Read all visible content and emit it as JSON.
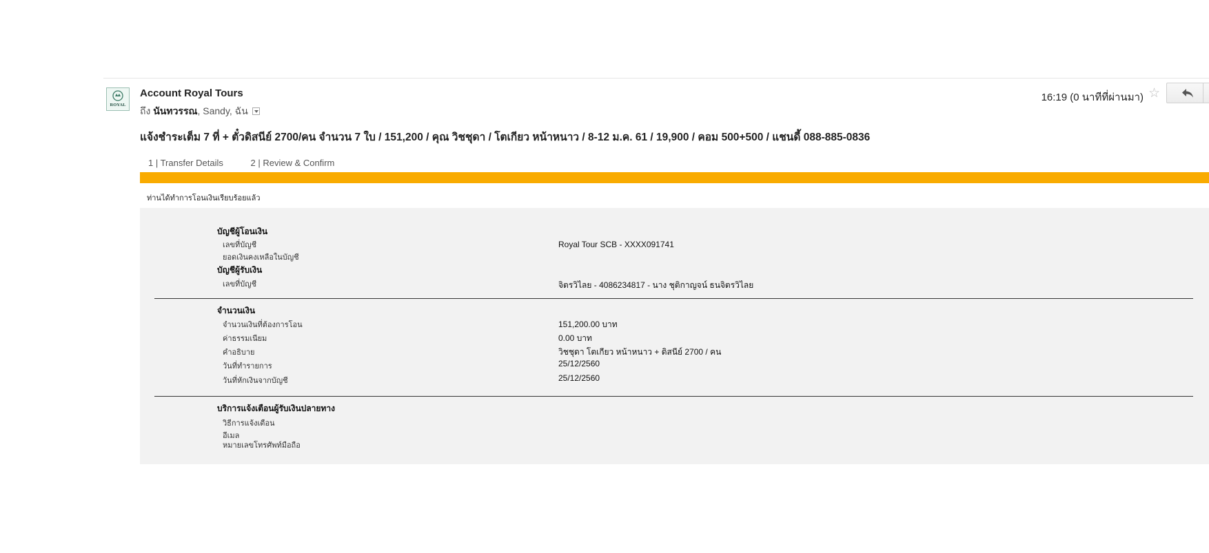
{
  "email": {
    "sender": "Account Royal Tours",
    "to_prefix": "ถึง",
    "recipient_bold": "นันทวรรณ",
    "recipient_rest": ", Sandy, ฉัน",
    "timestamp": "16:19 (0 นาทีที่ผ่านมา)",
    "subject": "แจ้งชำระเต็ม  7 ที่ + ตั๋วดิสนีย์ 2700/คน จำนวน 7 ใบ / 151,200 / คุณ วิชชุดา / โตเกียว หน้าหนาว / 8-12 ม.ค. 61 / 19,900 / คอม 500+500 / แชนดี้ 088-885-0836",
    "avatar_text": "ROYAL",
    "icons": {
      "avatar": "royal-logo",
      "star": "star-icon",
      "reply": "reply-icon",
      "recipient_menu": "dropdown-icon"
    }
  },
  "transfer": {
    "steps": [
      "1 | Transfer Details",
      "2 | Review & Confirm"
    ],
    "progress_color": "#f9ab00",
    "success_message": "ท่านได้ทำการโอนเงินเรียบร้อยแล้ว",
    "from_account": {
      "heading": "บัญชีผู้โอนเงิน",
      "account_label": "เลขที่บัญชี",
      "account_value": "Royal Tour SCB - XXXX091741",
      "balance_label": "ยอดเงินคงเหลือในบัญชี"
    },
    "to_account": {
      "heading": "บัญชีผู้รับเงิน",
      "account_label": "เลขที่บัญชี",
      "account_value": "จิตรวิไลย - 4086234817 - นาง ชุติกาญจน์ ธนจิตรวิไลย"
    },
    "amount": {
      "heading": "จำนวนเงิน",
      "rows": [
        {
          "label": "จำนวนเงินที่ต้องการโอน",
          "value": "151,200.00 บาท"
        },
        {
          "label": "ค่าธรรมเนียม",
          "value": "0.00  บาท"
        },
        {
          "label": "คำอธิบาย",
          "value": "วิชชุดา โตเกียว หน้าหนาว + ดิสนีย์ 2700 / คน"
        },
        {
          "label": "วันที่ทำรายการ",
          "value": "25/12/2560"
        },
        {
          "label": "วันที่หักเงินจากบัญชี",
          "value": "25/12/2560"
        }
      ]
    },
    "notification": {
      "heading": "บริการแจ้งเตือนผู้รับเงินปลายทาง",
      "rows": [
        "วิธีการแจ้งเตือน",
        "อีเมล",
        "หมายเลขโทรศัพท์มือถือ"
      ]
    }
  }
}
